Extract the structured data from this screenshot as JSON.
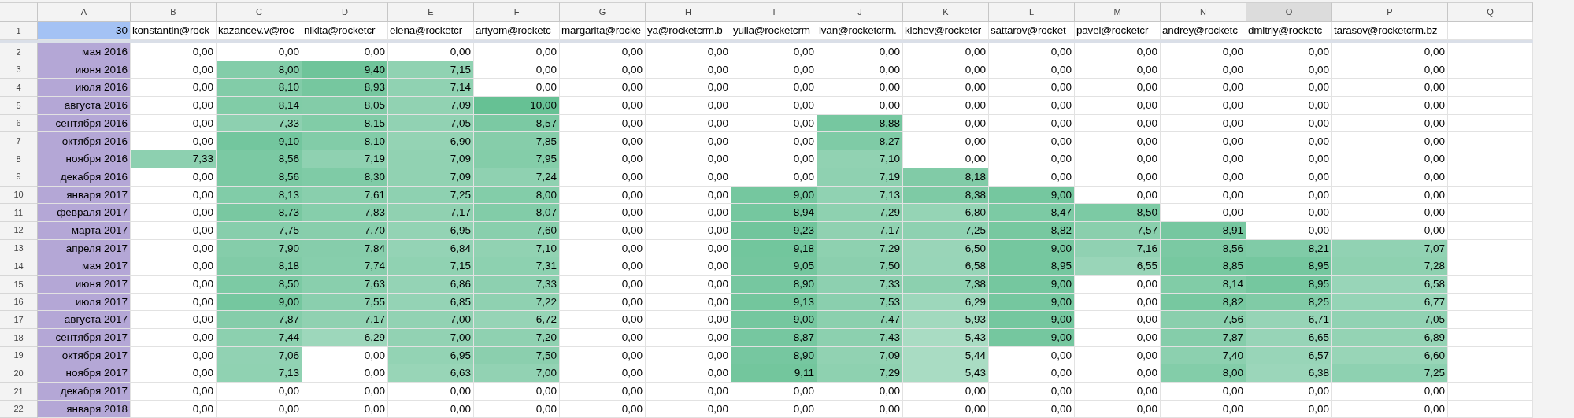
{
  "sheet": {
    "columns": [
      {
        "letter": "A",
        "selected": false
      },
      {
        "letter": "B",
        "selected": false
      },
      {
        "letter": "C",
        "selected": false
      },
      {
        "letter": "D",
        "selected": false
      },
      {
        "letter": "E",
        "selected": false
      },
      {
        "letter": "F",
        "selected": false
      },
      {
        "letter": "G",
        "selected": false
      },
      {
        "letter": "H",
        "selected": false
      },
      {
        "letter": "I",
        "selected": false
      },
      {
        "letter": "J",
        "selected": false
      },
      {
        "letter": "K",
        "selected": false
      },
      {
        "letter": "L",
        "selected": false
      },
      {
        "letter": "M",
        "selected": false
      },
      {
        "letter": "N",
        "selected": false
      },
      {
        "letter": "O",
        "selected": true
      },
      {
        "letter": "P",
        "selected": false
      },
      {
        "letter": "Q",
        "selected": false
      }
    ],
    "header_row": {
      "number": "1",
      "corner_value": "30",
      "emails": [
        "konstantin@rock",
        "kazancev.v@roc",
        "nikita@rocketcr",
        "elena@rocketcr",
        "artyom@rocketc",
        "margarita@rocke",
        "ya@rocketcrm.b",
        "yulia@rocketcrm",
        "ivan@rocketcrm.",
        "kichev@rocketcr",
        "sattarov@rocket",
        "pavel@rocketcr",
        "andrey@rocketc",
        "dmitriy@rocketc",
        "tarasov@rocketcrm.bz"
      ]
    },
    "rows": [
      {
        "number": "2",
        "label": "мая 2016",
        "values": [
          "0,00",
          "0,00",
          "0,00",
          "0,00",
          "0,00",
          "0,00",
          "0,00",
          "0,00",
          "0,00",
          "0,00",
          "0,00",
          "0,00",
          "0,00",
          "0,00",
          "0,00"
        ]
      },
      {
        "number": "3",
        "label": "июня 2016",
        "values": [
          "0,00",
          "8,00",
          "9,40",
          "7,15",
          "0,00",
          "0,00",
          "0,00",
          "0,00",
          "0,00",
          "0,00",
          "0,00",
          "0,00",
          "0,00",
          "0,00",
          "0,00"
        ]
      },
      {
        "number": "4",
        "label": "июля 2016",
        "values": [
          "0,00",
          "8,10",
          "8,93",
          "7,14",
          "0,00",
          "0,00",
          "0,00",
          "0,00",
          "0,00",
          "0,00",
          "0,00",
          "0,00",
          "0,00",
          "0,00",
          "0,00"
        ]
      },
      {
        "number": "5",
        "label": "августа 2016",
        "values": [
          "0,00",
          "8,14",
          "8,05",
          "7,09",
          "10,00",
          "0,00",
          "0,00",
          "0,00",
          "0,00",
          "0,00",
          "0,00",
          "0,00",
          "0,00",
          "0,00",
          "0,00"
        ]
      },
      {
        "number": "6",
        "label": "сентября 2016",
        "values": [
          "0,00",
          "7,33",
          "8,15",
          "7,05",
          "8,57",
          "0,00",
          "0,00",
          "0,00",
          "8,88",
          "0,00",
          "0,00",
          "0,00",
          "0,00",
          "0,00",
          "0,00"
        ]
      },
      {
        "number": "7",
        "label": "октября 2016",
        "values": [
          "0,00",
          "9,10",
          "8,10",
          "6,90",
          "7,85",
          "0,00",
          "0,00",
          "0,00",
          "8,27",
          "0,00",
          "0,00",
          "0,00",
          "0,00",
          "0,00",
          "0,00"
        ]
      },
      {
        "number": "8",
        "label": "ноября 2016",
        "values": [
          "7,33",
          "8,56",
          "7,19",
          "7,09",
          "7,95",
          "0,00",
          "0,00",
          "0,00",
          "7,10",
          "0,00",
          "0,00",
          "0,00",
          "0,00",
          "0,00",
          "0,00"
        ]
      },
      {
        "number": "9",
        "label": "декабря 2016",
        "values": [
          "0,00",
          "8,56",
          "8,30",
          "7,09",
          "7,24",
          "0,00",
          "0,00",
          "0,00",
          "7,19",
          "8,18",
          "0,00",
          "0,00",
          "0,00",
          "0,00",
          "0,00"
        ]
      },
      {
        "number": "10",
        "label": "января 2017",
        "values": [
          "0,00",
          "8,13",
          "7,61",
          "7,25",
          "8,00",
          "0,00",
          "0,00",
          "9,00",
          "7,13",
          "8,38",
          "9,00",
          "0,00",
          "0,00",
          "0,00",
          "0,00"
        ]
      },
      {
        "number": "11",
        "label": "февраля 2017",
        "values": [
          "0,00",
          "8,73",
          "7,83",
          "7,17",
          "8,07",
          "0,00",
          "0,00",
          "8,94",
          "7,29",
          "6,80",
          "8,47",
          "8,50",
          "0,00",
          "0,00",
          "0,00"
        ]
      },
      {
        "number": "12",
        "label": "марта 2017",
        "values": [
          "0,00",
          "7,75",
          "7,70",
          "6,95",
          "7,60",
          "0,00",
          "0,00",
          "9,23",
          "7,17",
          "7,25",
          "8,82",
          "7,57",
          "8,91",
          "0,00",
          "0,00"
        ]
      },
      {
        "number": "13",
        "label": "апреля 2017",
        "values": [
          "0,00",
          "7,90",
          "7,84",
          "6,84",
          "7,10",
          "0,00",
          "0,00",
          "9,18",
          "7,29",
          "6,50",
          "9,00",
          "7,16",
          "8,56",
          "8,21",
          "7,07"
        ]
      },
      {
        "number": "14",
        "label": "мая 2017",
        "values": [
          "0,00",
          "8,18",
          "7,74",
          "7,15",
          "7,31",
          "0,00",
          "0,00",
          "9,05",
          "7,50",
          "6,58",
          "8,95",
          "6,55",
          "8,85",
          "8,95",
          "7,28"
        ]
      },
      {
        "number": "15",
        "label": "июня 2017",
        "values": [
          "0,00",
          "8,50",
          "7,63",
          "6,86",
          "7,33",
          "0,00",
          "0,00",
          "8,90",
          "7,33",
          "7,38",
          "9,00",
          "0,00",
          "8,14",
          "8,95",
          "6,58"
        ]
      },
      {
        "number": "16",
        "label": "июля 2017",
        "values": [
          "0,00",
          "9,00",
          "7,55",
          "6,85",
          "7,22",
          "0,00",
          "0,00",
          "9,13",
          "7,53",
          "6,29",
          "9,00",
          "0,00",
          "8,82",
          "8,25",
          "6,77"
        ]
      },
      {
        "number": "17",
        "label": "августа 2017",
        "values": [
          "0,00",
          "7,87",
          "7,17",
          "7,00",
          "6,72",
          "0,00",
          "0,00",
          "9,00",
          "7,47",
          "5,93",
          "9,00",
          "0,00",
          "7,56",
          "6,71",
          "7,05"
        ]
      },
      {
        "number": "18",
        "label": "сентября 2017",
        "values": [
          "0,00",
          "7,44",
          "6,29",
          "7,00",
          "7,20",
          "0,00",
          "0,00",
          "8,87",
          "7,43",
          "5,43",
          "9,00",
          "0,00",
          "7,87",
          "6,65",
          "6,89"
        ]
      },
      {
        "number": "19",
        "label": "октября 2017",
        "values": [
          "0,00",
          "7,06",
          "0,00",
          "6,95",
          "7,50",
          "0,00",
          "0,00",
          "8,90",
          "7,09",
          "5,44",
          "0,00",
          "0,00",
          "7,40",
          "6,57",
          "6,60"
        ]
      },
      {
        "number": "20",
        "label": "ноября 2017",
        "values": [
          "0,00",
          "7,13",
          "0,00",
          "6,63",
          "7,00",
          "0,00",
          "0,00",
          "9,11",
          "7,29",
          "5,43",
          "0,00",
          "0,00",
          "8,00",
          "6,38",
          "7,25"
        ]
      },
      {
        "number": "21",
        "label": "декабря 2017",
        "values": [
          "0,00",
          "0,00",
          "0,00",
          "0,00",
          "0,00",
          "0,00",
          "0,00",
          "0,00",
          "0,00",
          "0,00",
          "0,00",
          "0,00",
          "0,00",
          "0,00",
          "0,00"
        ]
      },
      {
        "number": "22",
        "label": "января 2018",
        "values": [
          "0,00",
          "0,00",
          "0,00",
          "0,00",
          "0,00",
          "0,00",
          "0,00",
          "0,00",
          "0,00",
          "0,00",
          "0,00",
          "0,00",
          "0,00",
          "0,00",
          "0,00"
        ]
      }
    ]
  }
}
